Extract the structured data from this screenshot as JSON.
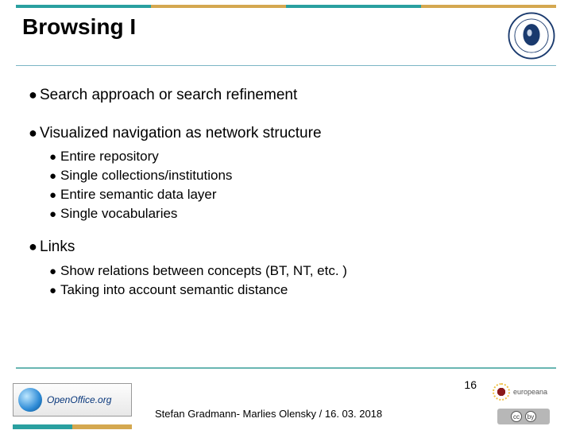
{
  "title": "Browsing I",
  "bullets": {
    "b1": "Search approach or search refinement",
    "b2": "Visualized navigation as network structure",
    "b2_children": [
      "Entire repository",
      "Single collections/institutions",
      "Entire semantic data layer",
      "Single vocabularies"
    ],
    "b3": "Links",
    "b3_children": [
      "Show relations between concepts (BT, NT, etc. )",
      "Taking into account semantic distance"
    ]
  },
  "footer": {
    "oo_label": "OpenOffice.org",
    "credit": "Stefan Gradmann- Marlies Olensky / 16. 03. 2018",
    "page": "16",
    "eu_label": "europeana",
    "cc": [
      "cc",
      "by"
    ]
  }
}
